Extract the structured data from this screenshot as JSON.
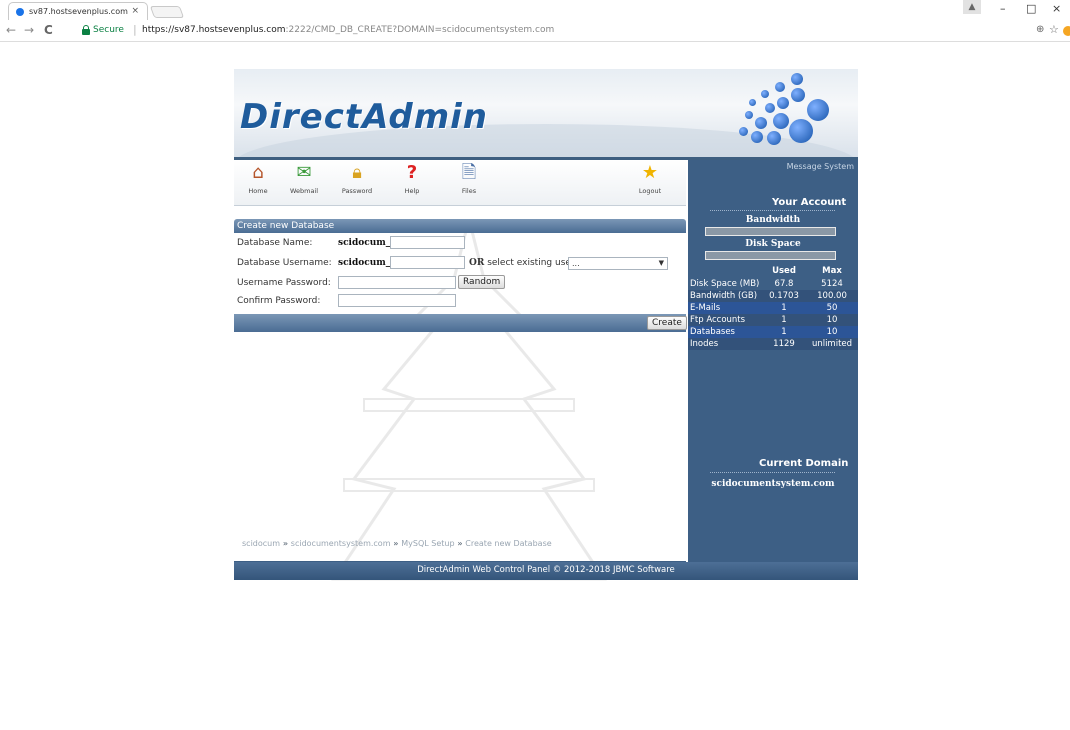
{
  "browser": {
    "tab_title": "sv87.hostsevenplus.com",
    "tab_close": "×",
    "secure_label": "Secure",
    "url_host": "https://sv87.hostsevenplus.com",
    "url_rest": ":2222/CMD_DB_CREATE?DOMAIN=scidocumentsystem.com",
    "back_icon": "←",
    "forward_icon": "→",
    "reload_icon": "C",
    "minimize_icon": "–",
    "restore_icon": "□",
    "close_icon": "×"
  },
  "header": {
    "logo": "DirectAdmin"
  },
  "toolbar": {
    "items": [
      {
        "label": "Home",
        "icon": "house-icon"
      },
      {
        "label": "Webmail",
        "icon": "mail-icon"
      },
      {
        "label": "Password",
        "icon": "lock-icon"
      },
      {
        "label": "Help",
        "icon": "question-icon"
      },
      {
        "label": "Files",
        "icon": "files-icon"
      },
      {
        "label": "Logout",
        "icon": "star-icon"
      }
    ]
  },
  "form": {
    "section_title": "Create new Database",
    "db_name_label": "Database Name:",
    "db_name_prefix": "scidocum_",
    "db_user_label": "Database Username:",
    "db_user_prefix": "scidocum_",
    "or_bold": "OR",
    "or_rest": " select existing user",
    "existing_user_value": "...",
    "user_pass_label": "Username Password:",
    "random_button": "Random",
    "confirm_pass_label": "Confirm Password:",
    "create_button": "Create"
  },
  "breadcrumb": {
    "items": [
      "scidocum",
      "scidocumentsystem.com",
      "MySQL Setup",
      "Create new Database"
    ],
    "sep": " » "
  },
  "sidebar": {
    "message_system": "Message System",
    "your_account": "Your Account",
    "bandwidth": "Bandwidth",
    "disk_space": "Disk Space",
    "used_header": "Used",
    "max_header": "Max",
    "rows": [
      {
        "label": "Disk Space (MB)",
        "used": "67.8",
        "max": "5124"
      },
      {
        "label": "Bandwidth (GB)",
        "used": "0.1703",
        "max": "100.00"
      },
      {
        "label": "E-Mails",
        "used": "1",
        "max": "50"
      },
      {
        "label": "Ftp Accounts",
        "used": "1",
        "max": "10"
      },
      {
        "label": "Databases",
        "used": "1",
        "max": "10"
      },
      {
        "label": "Inodes",
        "used": "1129",
        "max": "unlimited"
      }
    ],
    "current_domain_label": "Current Domain",
    "current_domain": "scidocumentsystem.com"
  },
  "footer": {
    "text": "DirectAdmin Web Control Panel © 2012-2018 JBMC Software"
  }
}
